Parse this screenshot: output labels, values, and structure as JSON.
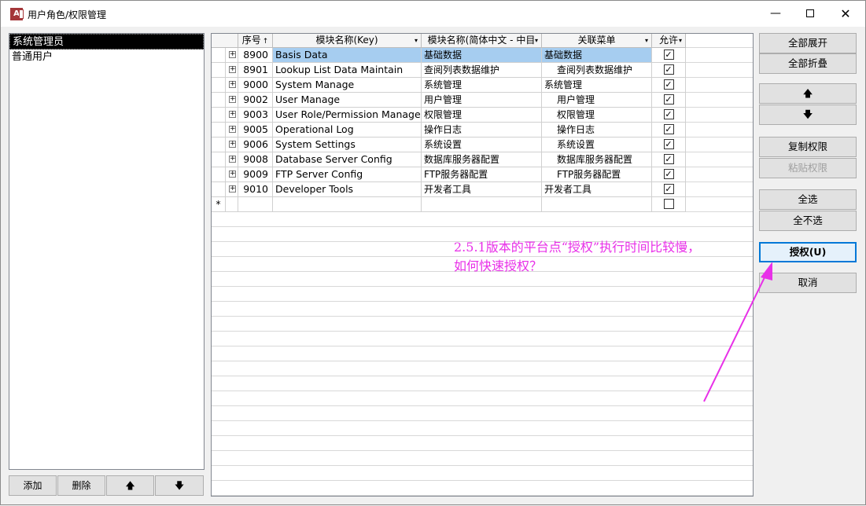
{
  "window": {
    "title": "用户角色/权限管理",
    "app_icon": "access-app-icon",
    "minimize_glyph": "—",
    "close_glyph": "✕"
  },
  "roles": [
    "系统管理员",
    "普通用户"
  ],
  "role_buttons": {
    "add": "添加",
    "delete": "删除",
    "up_icon": "arrow-up-icon",
    "down_icon": "arrow-down-icon",
    "up_glyph": "🡅",
    "down_glyph": "🡇"
  },
  "grid": {
    "headers": {
      "seq": "序号",
      "key": "模块名称(Key)",
      "cn": "模块名称(简体中文 - 中目",
      "menu": "关联菜单",
      "allow": "允许"
    },
    "sort_glyph": "↑",
    "dropdown_glyph": "▾",
    "new_row_marker": "*",
    "expand_glyph": "+",
    "check_glyph": "✓",
    "rows": [
      {
        "id": "8900",
        "key": "Basis Data",
        "cn": "基础数据",
        "menu": "基础数据",
        "allowed": true,
        "selected": true,
        "indent": false
      },
      {
        "id": "8901",
        "key": "Lookup List Data Maintain",
        "cn": "查阅列表数据维护",
        "menu": "查阅列表数据维护",
        "allowed": true,
        "selected": false,
        "indent": true
      },
      {
        "id": "9000",
        "key": "System Manage",
        "cn": "系统管理",
        "menu": "系统管理",
        "allowed": true,
        "selected": false,
        "indent": false
      },
      {
        "id": "9002",
        "key": "User Manage",
        "cn": "用户管理",
        "menu": "用户管理",
        "allowed": true,
        "selected": false,
        "indent": true
      },
      {
        "id": "9003",
        "key": "User Role/Permission Manage",
        "cn": "权限管理",
        "menu": "权限管理",
        "allowed": true,
        "selected": false,
        "indent": true
      },
      {
        "id": "9005",
        "key": "Operational Log",
        "cn": "操作日志",
        "menu": "操作日志",
        "allowed": true,
        "selected": false,
        "indent": true
      },
      {
        "id": "9006",
        "key": "System Settings",
        "cn": "系统设置",
        "menu": "系统设置",
        "allowed": true,
        "selected": false,
        "indent": true
      },
      {
        "id": "9008",
        "key": "Database Server Config",
        "cn": "数据库服务器配置",
        "menu": "数据库服务器配置",
        "allowed": true,
        "selected": false,
        "indent": true
      },
      {
        "id": "9009",
        "key": "FTP Server Config",
        "cn": "FTP服务器配置",
        "menu": "FTP服务器配置",
        "allowed": true,
        "selected": false,
        "indent": true
      },
      {
        "id": "9010",
        "key": "Developer Tools",
        "cn": "开发者工具",
        "menu": "开发者工具",
        "allowed": true,
        "selected": false,
        "indent": false
      }
    ],
    "new_row_allowed": false
  },
  "annotation": {
    "line1": "2.5.1版本的平台点“授权”执行时间比较慢，",
    "line2": "如何快速授权？",
    "color": "#e830e8"
  },
  "actions": {
    "expand_all": "全部展开",
    "collapse_all": "全部折叠",
    "up_glyph": "🡅",
    "down_glyph": "🡇",
    "copy_perm": "复制权限",
    "paste_perm": "粘贴权限",
    "select_all": "全选",
    "select_none": "全不选",
    "authorize": "授权(U)",
    "cancel": "取消"
  }
}
